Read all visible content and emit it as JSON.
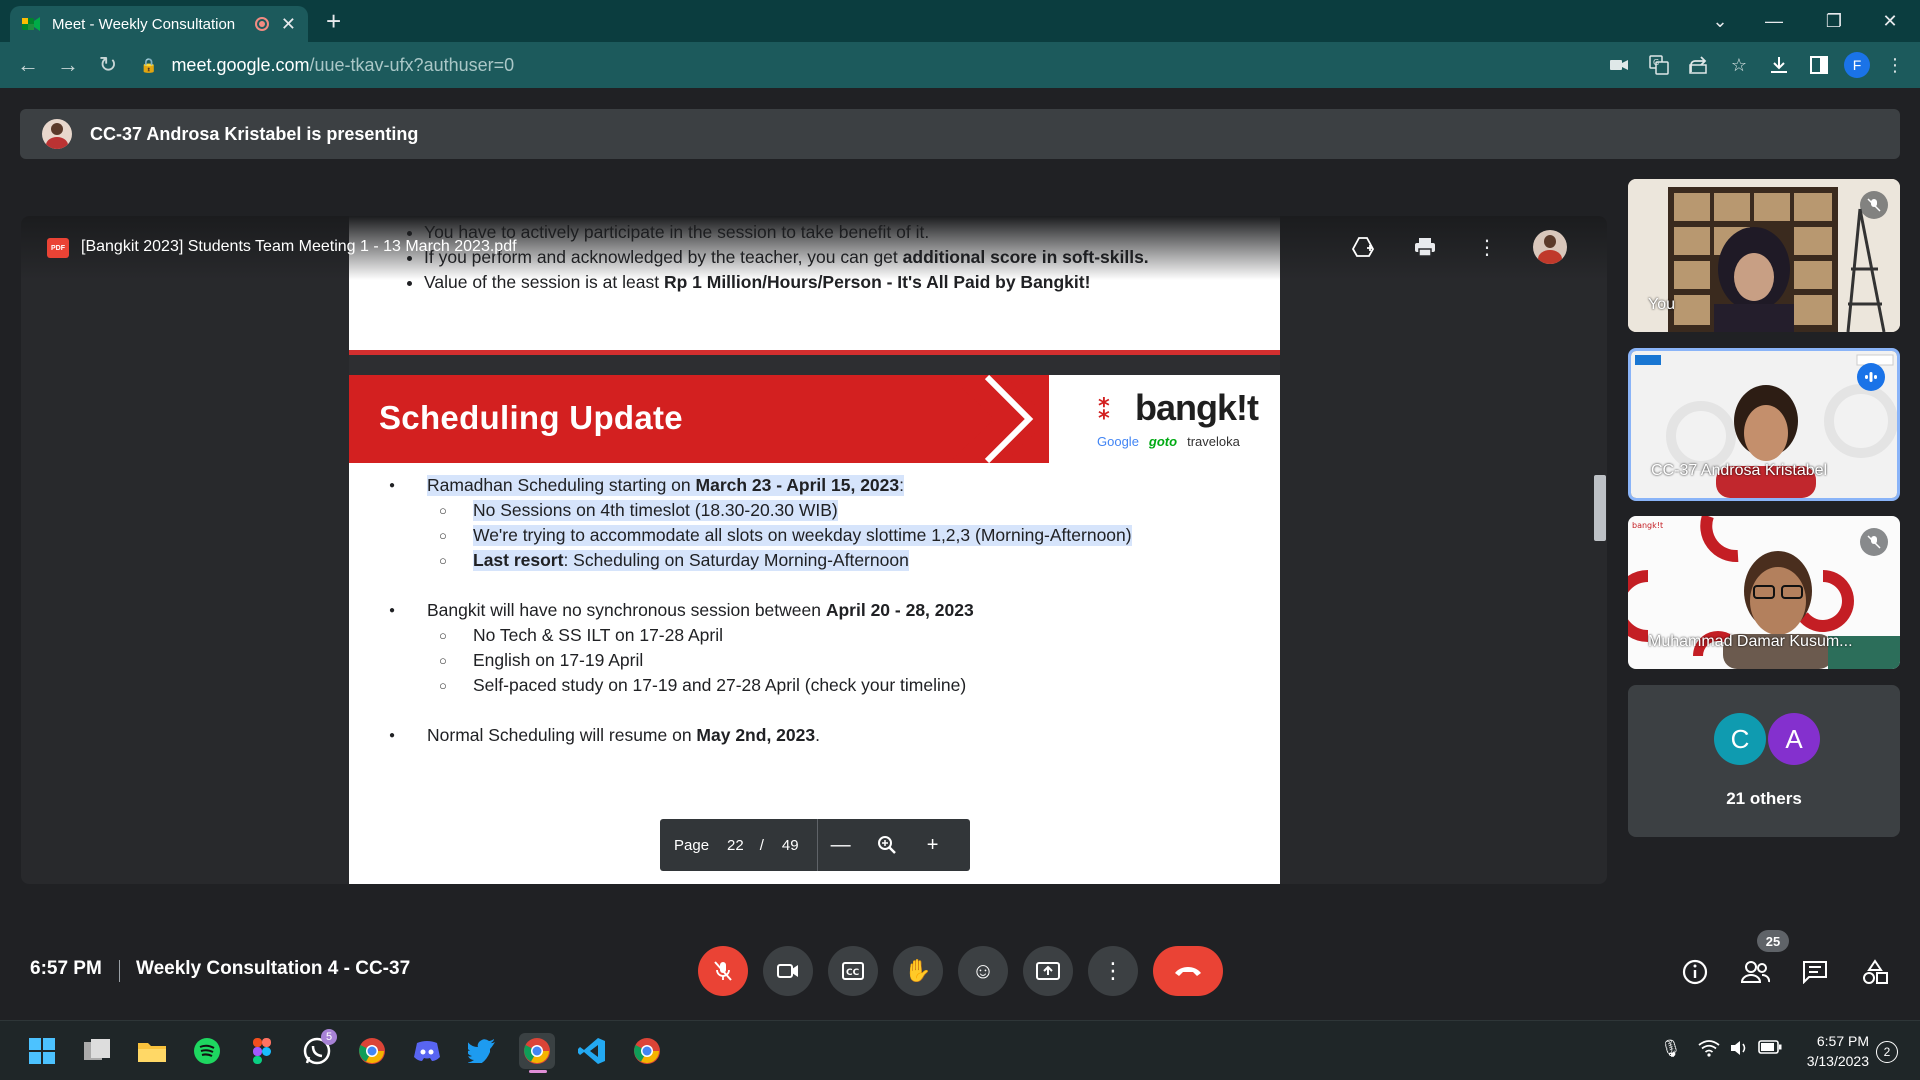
{
  "browser": {
    "tab_title": "Meet - Weekly Consultation",
    "url_host": "meet.google.com",
    "url_path": "/uue-tkav-ufx?authuser=0",
    "profile_initial": "F"
  },
  "banner": {
    "text": "CC-37 Androsa Kristabel is presenting"
  },
  "pdf": {
    "icon_label": "PDF",
    "title": "[Bangkit 2023] Students Team Meeting 1 - 13 March 2023.pdf",
    "prev_slide_bullets": [
      {
        "pre": "You have to actively participate in the session to take benefit of it.",
        "bold": "",
        "post": ""
      },
      {
        "pre": "If you perform and acknowledged by the teacher, you can get ",
        "bold": "additional score in soft-skills.",
        "post": ""
      },
      {
        "pre": "Value of the session is at least ",
        "bold": "Rp 1 Million/Hours/Person - It's All Paid by Bangkit!",
        "post": ""
      }
    ],
    "slide": {
      "title": "Scheduling Update",
      "brand_word": "bangk!t",
      "partners": [
        "Google",
        "goto",
        "traveloka"
      ],
      "b1_pre": "Ramadhan Scheduling starting on ",
      "b1_bold": "March 23 - April 15, 2023",
      "b1_post": ":",
      "b1_sub1": "No Sessions on 4th timeslot (18.30-20.30 WIB)",
      "b1_sub2": "We're trying to accommodate all slots on weekday slottime 1,2,3 (Morning-Afternoon)",
      "b1_sub3_bold": "Last resort",
      "b1_sub3_post": ": Scheduling on Saturday Morning-Afternoon",
      "b2_pre": "Bangkit will have no synchronous session between ",
      "b2_bold": "April 20 - 28, 2023",
      "b2_sub1": "No Tech & SS ILT on 17-28 April",
      "b2_sub2": "English on 17-19 April",
      "b2_sub3": "Self-paced study on 17-19 and 27-28 April (check your timeline)",
      "b3_pre": "Normal Scheduling will resume on ",
      "b3_bold": "May 2nd, 2023",
      "b3_post": "."
    },
    "pager": {
      "label": "Page",
      "current": "22",
      "slash": "/",
      "total": "49"
    }
  },
  "tiles": {
    "self_name": "You",
    "presenter_name": "CC-37 Androsa Kristabel",
    "third_name": "Muhammad Damar Kusum...",
    "others_initials": [
      "C",
      "A"
    ],
    "others_label": "21 others"
  },
  "bottom": {
    "time": "6:57 PM",
    "meeting_name": "Weekly Consultation 4 - CC-37",
    "participants_count": "25"
  },
  "taskbar": {
    "time": "6:57 PM",
    "date": "3/13/2023",
    "notifications": "2",
    "whatsapp_badge": "5"
  },
  "colors": {
    "chrome_frame": "#0b3d3f",
    "chrome_toolbar": "#1c5a5c",
    "meet_bg": "#202124",
    "slide_red": "#d32020",
    "end_call": "#ea4335",
    "highlight": "#d6e4fb"
  }
}
